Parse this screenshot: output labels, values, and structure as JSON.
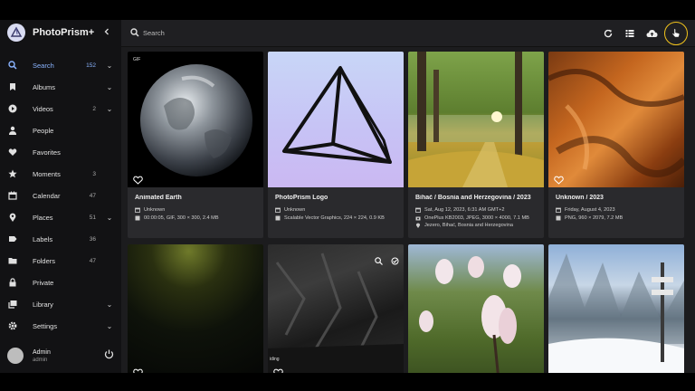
{
  "app": {
    "title": "PhotoPrism+"
  },
  "sidebar": {
    "items": [
      {
        "label": "Search",
        "count": "152",
        "chevron": true,
        "icon": "search-icon",
        "active": true
      },
      {
        "label": "Albums",
        "count": "",
        "chevron": true,
        "icon": "bookmark-icon"
      },
      {
        "label": "Videos",
        "count": "2",
        "chevron": true,
        "icon": "play-icon"
      },
      {
        "label": "People",
        "count": "",
        "chevron": false,
        "icon": "person-icon"
      },
      {
        "label": "Favorites",
        "count": "",
        "chevron": false,
        "icon": "heart-icon"
      },
      {
        "label": "Moments",
        "count": "3",
        "chevron": false,
        "icon": "star-icon"
      },
      {
        "label": "Calendar",
        "count": "47",
        "chevron": false,
        "icon": "calendar-icon"
      },
      {
        "label": "Places",
        "count": "51",
        "chevron": true,
        "icon": "pin-icon"
      },
      {
        "label": "Labels",
        "count": "36",
        "chevron": false,
        "icon": "label-icon"
      },
      {
        "label": "Folders",
        "count": "47",
        "chevron": false,
        "icon": "folder-icon"
      },
      {
        "label": "Private",
        "count": "",
        "chevron": false,
        "icon": "lock-icon"
      },
      {
        "label": "Library",
        "count": "",
        "chevron": true,
        "icon": "library-icon"
      },
      {
        "label": "Settings",
        "count": "",
        "chevron": true,
        "icon": "gear-icon"
      }
    ],
    "user": {
      "name": "Admin",
      "role": "admin"
    }
  },
  "search": {
    "placeholder": "Search"
  },
  "colors": {
    "accent": "#8ab4ff",
    "highlight": "#f2c31b",
    "sidebar_bg": "#121214",
    "card_bg": "#2a2a2d"
  },
  "cards": [
    {
      "title": "Animated Earth",
      "tag": "GIF",
      "lines": [
        {
          "icon": "calendar-icon",
          "text": "Unknown"
        },
        {
          "icon": "file-icon",
          "text": "00:00:05, GIF, 300 × 300, 2.4 MB"
        }
      ]
    },
    {
      "title": "PhotoPrism Logo",
      "lines": [
        {
          "icon": "calendar-icon",
          "text": "Unknown"
        },
        {
          "icon": "file-icon",
          "text": "Scalable Vector Graphics, 224 × 224, 0.9 KB"
        }
      ]
    },
    {
      "title": "Bihać / Bosnia and Herzegovina / 2023",
      "lines": [
        {
          "icon": "calendar-icon",
          "text": "Sat, Aug 12, 2023, 6:31 AM GMT+2"
        },
        {
          "icon": "camera-icon",
          "text": "OnePlus KB2003, JPEG, 3000 × 4000, 7.1 MB"
        },
        {
          "icon": "pin-icon",
          "text": "Jezero, Bihać, Bosnia and Herzegovina"
        }
      ]
    },
    {
      "title": "Unknown / 2023",
      "lines": [
        {
          "icon": "calendar-icon",
          "text": "Friday, August 4, 2023"
        },
        {
          "icon": "file-icon",
          "text": "PNG, 960 × 2079, 7.2 MB"
        }
      ]
    },
    {
      "title": "",
      "tag": ""
    },
    {
      "title": "",
      "tag": "iding"
    },
    {
      "title": ""
    },
    {
      "title": ""
    }
  ]
}
